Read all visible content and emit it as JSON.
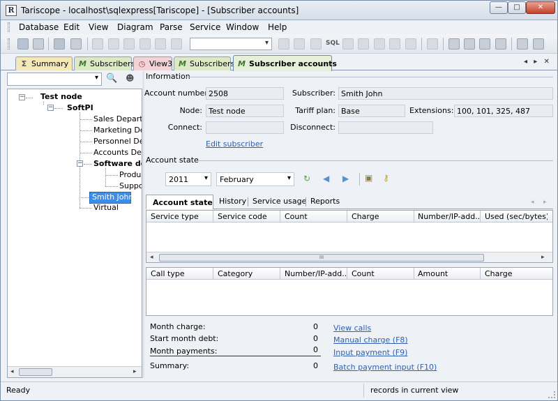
{
  "window": {
    "title": "Tariscope - localhost\\sqlexpress[Tariscope] - [Subscriber accounts]",
    "app_icon": "R",
    "controls": {
      "minimize": "—",
      "maximize": "□",
      "close": "✕"
    }
  },
  "menu": [
    "Database",
    "Edit",
    "View",
    "Diagram",
    "Parse",
    "Service",
    "Window",
    "Help"
  ],
  "toolbar": {
    "sql_label": "SQL"
  },
  "tabs": [
    {
      "label": "Summary",
      "icon": "Σ"
    },
    {
      "label": "Subscribers",
      "icon": "M"
    },
    {
      "label": "View3",
      "icon": "◷"
    },
    {
      "label": "Subscribers",
      "icon": "M"
    },
    {
      "label": "Subscriber accounts",
      "icon": "M"
    }
  ],
  "tab_nav": {
    "prev": "◂",
    "next": "▸",
    "close": "✕"
  },
  "tree": {
    "root": "Test node",
    "org": "SoftPI",
    "departments": [
      "Sales Department",
      "Marketing Department",
      "Personnel Department",
      "Accounts Department"
    ],
    "software": "Software department",
    "software_children": [
      "Production",
      "Support"
    ],
    "selected": "Smith John",
    "virtual": "Virtual"
  },
  "info": {
    "section_title": "Information",
    "account_number_label": "Account number:",
    "account_number": "2508",
    "subscriber_label": "Subscriber:",
    "subscriber": "Smith John",
    "node_label": "Node:",
    "node": "Test node",
    "tariff_label": "Tariff plan:",
    "tariff": "Base",
    "extensions_label": "Extensions:",
    "extensions": "100, 101, 325, 487",
    "connect_label": "Connect:",
    "connect": "",
    "disconnect_label": "Disconnect:",
    "disconnect": "",
    "edit_link": "Edit subscriber"
  },
  "state": {
    "section_title": "Account state",
    "year": "2011",
    "month": "February"
  },
  "inner_tabs": [
    "Account state",
    "History",
    "Service usage",
    "Reports"
  ],
  "grid1": {
    "columns": [
      "Service type",
      "Service code",
      "Count",
      "Charge",
      "Number/IP-add...",
      "Used (sec/bytes)"
    ]
  },
  "grid2": {
    "columns": [
      "Call type",
      "Category",
      "Number/IP-add...",
      "Count",
      "Amount",
      "Charge"
    ]
  },
  "scroll_thumb_grip": "III",
  "summary": {
    "month_charge_label": "Month charge:",
    "month_charge": "0",
    "start_debt_label": "Start month debt:",
    "start_debt": "0",
    "payments_label": "Month payments:",
    "payments": "0",
    "summary_label": "Summary:",
    "summary_value": "0",
    "links": [
      "View calls",
      "Manual charge (F8)",
      "Input payment (F9)",
      "Batch payment input (F10)"
    ]
  },
  "status": {
    "left": "Ready",
    "right": "records in current view"
  }
}
